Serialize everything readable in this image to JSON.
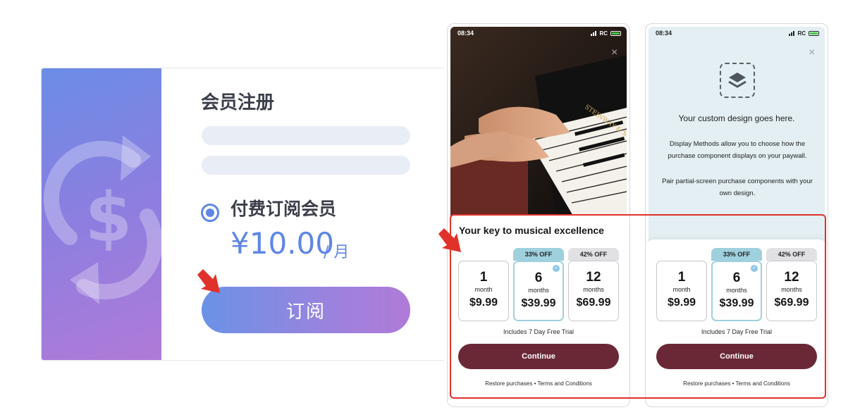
{
  "membership_card": {
    "title": "会员注册",
    "plan_name": "付费订阅会员",
    "price": "¥10.00",
    "period": "/ 月",
    "subscribe_label": "订阅",
    "accent_color": "#5f86e6"
  },
  "phone_left": {
    "status_time": "08:34",
    "carrier": "RC",
    "close_icon": "×",
    "headline": "Your key to musical excellence",
    "options": [
      {
        "badge": "",
        "number": "1",
        "unit": "month",
        "price": "$9.99",
        "selected": false
      },
      {
        "badge": "33% OFF",
        "number": "6",
        "unit": "months",
        "price": "$39.99",
        "selected": true
      },
      {
        "badge": "42% OFF",
        "number": "12",
        "unit": "months",
        "price": "$69.99",
        "selected": false
      }
    ],
    "trial_note": "Includes 7 Day Free Trial",
    "continue_label": "Continue",
    "restore_label": "Restore purchases",
    "separator": "•",
    "terms_label": "Terms and Conditions"
  },
  "phone_right": {
    "status_time": "08:34",
    "carrier": "RC",
    "close_icon": "×",
    "custom_title": "Your custom design goes here.",
    "custom_text_1": "Display Methods allow you to choose how the purchase component displays on your paywall.",
    "custom_text_2": "Pair partial-screen purchase components with your own design.",
    "options": [
      {
        "badge": "",
        "number": "1",
        "unit": "month",
        "price": "$9.99",
        "selected": false
      },
      {
        "badge": "33% OFF",
        "number": "6",
        "unit": "months",
        "price": "$39.99",
        "selected": true
      },
      {
        "badge": "42% OFF",
        "number": "12",
        "unit": "months",
        "price": "$69.99",
        "selected": false
      }
    ],
    "trial_note": "Includes 7 Day Free Trial",
    "continue_label": "Continue",
    "restore_label": "Restore purchases",
    "separator": "•",
    "terms_label": "Terms and Conditions"
  },
  "colors": {
    "continue_button": "#6a2836",
    "highlight_badge": "#9fd0dd",
    "annotation_red": "#e0322b"
  },
  "icons": {
    "card_side": "dollar-refresh-icon",
    "arrow": "red-arrow-icon",
    "design_placeholder": "layers-icon"
  }
}
